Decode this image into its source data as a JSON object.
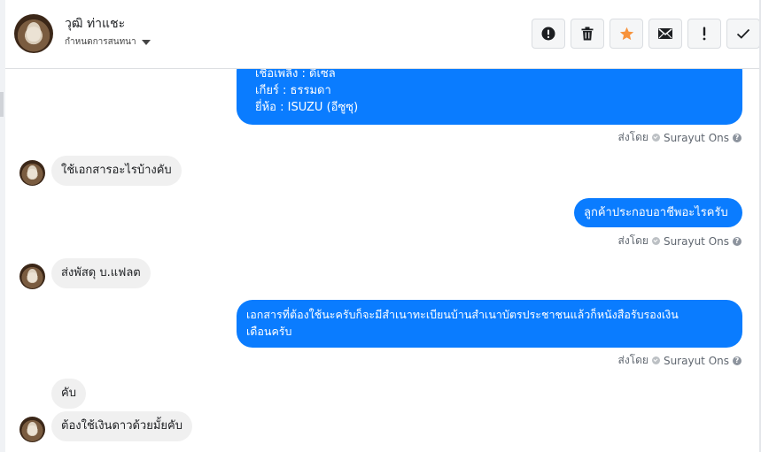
{
  "header": {
    "contact_name": "วุฒิ ท่าแชะ",
    "conversation_status": "กำหนดการสนทนา",
    "actions": [
      {
        "name": "alert-button",
        "icon": "exclamation-circle-icon"
      },
      {
        "name": "delete-button",
        "icon": "trash-icon"
      },
      {
        "name": "star-button",
        "icon": "star-icon"
      },
      {
        "name": "mark-unread-button",
        "icon": "envelope-icon"
      },
      {
        "name": "spam-button",
        "icon": "exclamation-icon"
      },
      {
        "name": "done-button",
        "icon": "check-icon"
      }
    ]
  },
  "messages": [
    {
      "direction": "out",
      "lines": [
        "เชื้อเพลิง : ดีเซล",
        "เกียร์ : ธรรมดา",
        "ยี่ห้อ : ISUZU (อีซูซุ)"
      ],
      "sent_by_prefix": "ส่งโดย",
      "sent_by_name": "Surayut Ons"
    },
    {
      "direction": "in",
      "text": "ใช้เอกสารอะไรบ้างคับ"
    },
    {
      "direction": "out",
      "text": "ลูกค้าประกอบอาชีพอะไรครับ",
      "sent_by_prefix": "ส่งโดย",
      "sent_by_name": "Surayut Ons"
    },
    {
      "direction": "in",
      "text": "ส่งพัสดุ บ.แฟลต"
    },
    {
      "direction": "out",
      "lines": [
        "เอกสารที่ต้องใช้นะครับก็จะมีสำเนาทะเบียนบ้านสำเนาบัตรประชาชนแล้วก็หนังสือรับรองเงิน",
        "เดือนครับ"
      ],
      "sent_by_prefix": "ส่งโดย",
      "sent_by_name": "Surayut Ons"
    },
    {
      "direction": "in",
      "text": "คับ"
    },
    {
      "direction": "in",
      "text": "ต้องใช้เงินดาวด้วยมั้ยคับ"
    }
  ],
  "colors": {
    "outgoing_bubble": "#0a7cff",
    "incoming_bubble": "#f0f0f0",
    "star": "#f7923b"
  }
}
